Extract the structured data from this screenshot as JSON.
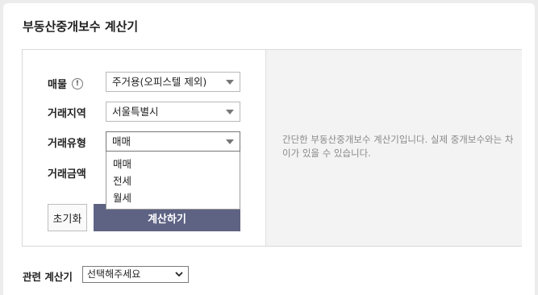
{
  "title": "부동산중개보수 계산기",
  "form": {
    "property": {
      "label": "매물",
      "info_icon": "!",
      "value": "주거용(오피스텔 제외)"
    },
    "region": {
      "label": "거래지역",
      "value": "서울특별시"
    },
    "type": {
      "label": "거래유형",
      "value": "매매",
      "options": [
        "매매",
        "전세",
        "월세"
      ]
    },
    "amount": {
      "label": "거래금액"
    },
    "reset_label": "초기화",
    "calc_label": "계산하기"
  },
  "info_text": "간단한 부동산중개보수 계산기입니다. 실제 중개보수와는 차이가 있을 수 있습니다.",
  "related": {
    "label": "관련 계산기",
    "value": "선택해주세요"
  },
  "colors": {
    "calc_button": "#5e6384",
    "panel_right": "#f3f3f3",
    "background": "#ececec"
  },
  "icons": {
    "info": "info-icon",
    "caret": "caret-down-icon",
    "chevron": "chevron-down-icon"
  }
}
